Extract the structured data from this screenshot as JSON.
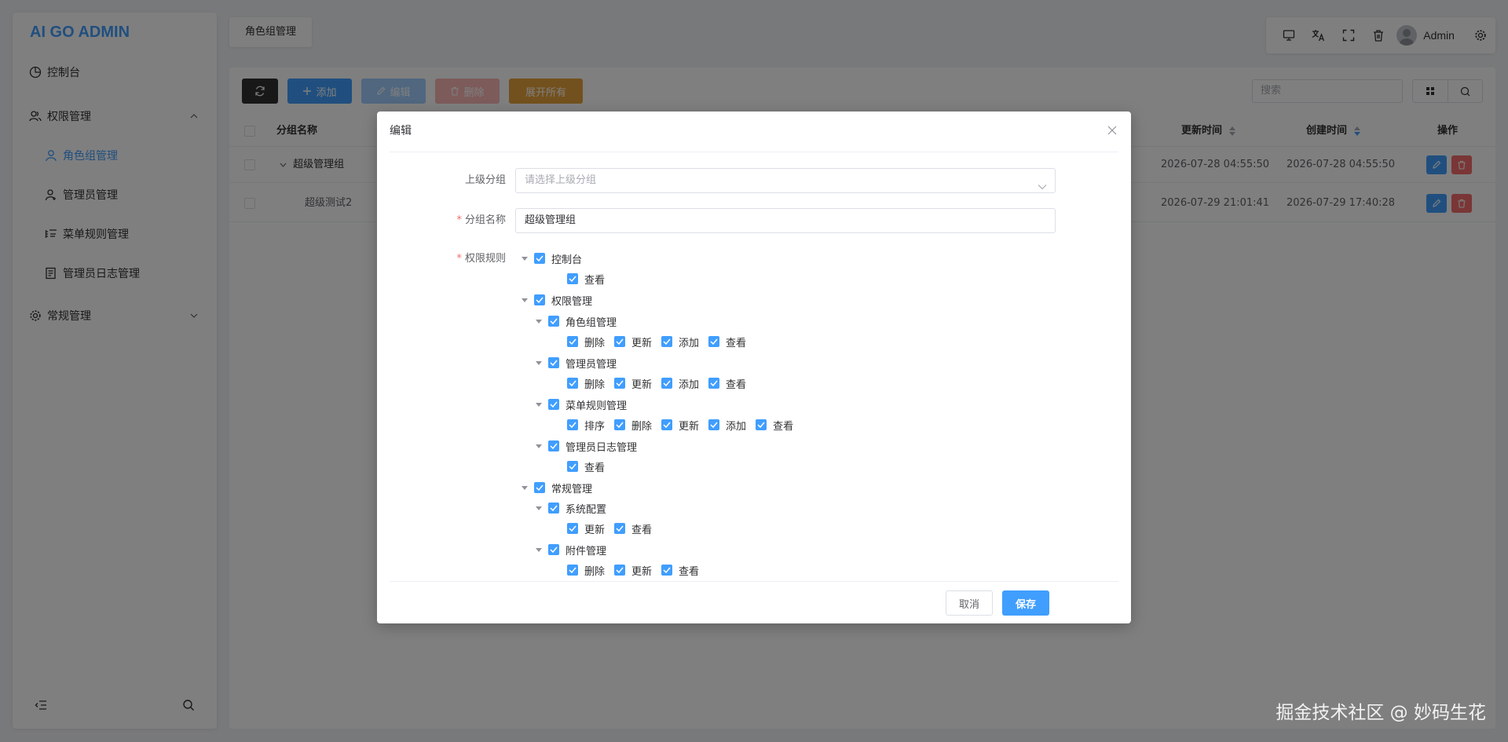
{
  "app": {
    "logo": "AI GO ADMIN"
  },
  "sidebar": {
    "items": [
      {
        "label": "控制台",
        "icon": "dashboard-icon"
      },
      {
        "label": "权限管理",
        "icon": "users-icon",
        "expanded": true
      },
      {
        "label": "角色组管理",
        "icon": "user-group-icon",
        "active": true
      },
      {
        "label": "管理员管理",
        "icon": "user-admin-icon"
      },
      {
        "label": "菜单规则管理",
        "icon": "menu-rule-icon"
      },
      {
        "label": "管理员日志管理",
        "icon": "log-icon"
      },
      {
        "label": "常规管理",
        "icon": "gear-icon",
        "expanded": false
      }
    ]
  },
  "tabs": {
    "active": "角色组管理"
  },
  "topbar": {
    "username": "Admin"
  },
  "toolbar": {
    "add_label": "添加",
    "edit_label": "编辑",
    "delete_label": "删除",
    "expand_label": "展开所有",
    "search_placeholder": "搜索"
  },
  "table": {
    "headers": {
      "name": "分组名称",
      "updated": "更新时间",
      "created": "创建时间",
      "actions": "操作"
    },
    "rows": [
      {
        "name": "超级管理组",
        "updated": "2026-07-28 04:55:50",
        "created": "2026-07-28 04:55:50"
      },
      {
        "name": "超级测试2",
        "updated": "2026-07-29 21:01:41",
        "created": "2026-07-29 17:40:28"
      }
    ]
  },
  "dialog": {
    "title": "编辑",
    "parent_label": "上级分组",
    "parent_placeholder": "请选择上级分组",
    "name_label": "分组名称",
    "name_value": "超级管理组",
    "rules_label": "权限规则",
    "cancel_label": "取消",
    "save_label": "保存",
    "tree": {
      "dashboard": {
        "label": "控制台",
        "children": [
          "查看"
        ]
      },
      "auth": {
        "label": "权限管理",
        "role": {
          "label": "角色组管理",
          "children": [
            "删除",
            "更新",
            "添加",
            "查看"
          ]
        },
        "admin": {
          "label": "管理员管理",
          "children": [
            "删除",
            "更新",
            "添加",
            "查看"
          ]
        },
        "menu": {
          "label": "菜单规则管理",
          "children": [
            "排序",
            "删除",
            "更新",
            "添加",
            "查看"
          ]
        },
        "log": {
          "label": "管理员日志管理",
          "children": [
            "查看"
          ]
        }
      },
      "routine": {
        "label": "常规管理",
        "config": {
          "label": "系统配置",
          "children": [
            "更新",
            "查看"
          ]
        },
        "attachment": {
          "label": "附件管理",
          "children": [
            "删除",
            "更新",
            "查看"
          ]
        }
      }
    }
  },
  "watermark": "掘金技术社区 @ 妙码生花",
  "colors": {
    "primary": "#409eff",
    "danger": "#f56c6c",
    "warning": "#e6a23c",
    "dark": "#303133"
  }
}
